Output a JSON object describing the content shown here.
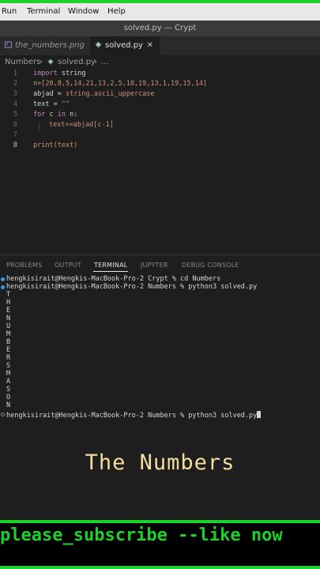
{
  "menu": [
    "Run",
    "Terminal",
    "Window",
    "Help"
  ],
  "window_title": "solved.py — Crypt",
  "tabs": [
    {
      "label": "the_numbers.png",
      "active": false
    },
    {
      "label": "solved.py",
      "active": true,
      "close": "✕"
    }
  ],
  "breadcrumb": [
    "Numbers",
    "›",
    "solved.py",
    "›",
    "..."
  ],
  "editor": {
    "line_numbers": [
      "1",
      "2",
      "3",
      "4",
      "5",
      "6",
      "7",
      "8"
    ],
    "lines": {
      "l1": {
        "kw": "import",
        "rest": " string"
      },
      "l2": {
        "text": "n=[20,8,5,14,21,13,2,5,18,19,13,1,19,15,14]"
      },
      "l3": {
        "a": "abjad = ",
        "b": "string.ascii_uppercase"
      },
      "l4": {
        "a": "text = ",
        "b": "\"\""
      },
      "l5": {
        "kw1": "for",
        "a": " c ",
        "kw2": "in",
        "b": " n:"
      },
      "l6": {
        "text": "text+=abjad[c-1]"
      },
      "l8": {
        "fn": "print",
        "rest": "(text)"
      }
    }
  },
  "panel_tabs": [
    "PROBLEMS",
    "OUTPUT",
    "TERMINAL",
    "JUPYTER",
    "DEBUG CONSOLE"
  ],
  "terminal": {
    "cmd1": "hengkisirait@Hengkis-MacBook-Pro-2 Crypt % cd Numbers",
    "cmd2": "hengkisirait@Hengkis-MacBook-Pro-2 Numbers % python3 solved.py",
    "output": [
      "T",
      "H",
      "E",
      "N",
      "U",
      "M",
      "B",
      "E",
      "R",
      "S",
      "M",
      "A",
      "S",
      "O",
      "N"
    ],
    "cmd3": "hengkisirait@Hengkis-MacBook-Pro-2 Numbers % python3 solved.py"
  },
  "overlay_caption": "The Numbers",
  "banner": "please_subscribe --like now",
  "colors": {
    "accent_green": "#1ed12a",
    "caption": "#f7dca0",
    "editor_bg": "#1e1e1e"
  }
}
